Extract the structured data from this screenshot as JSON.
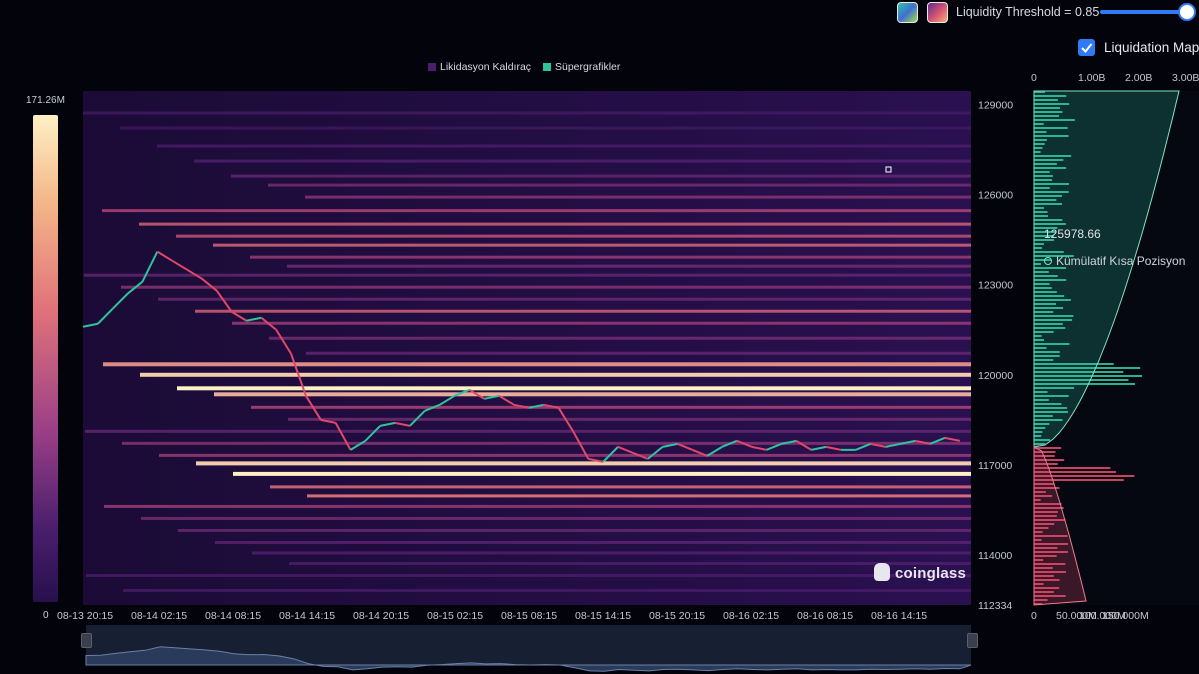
{
  "controls": {
    "threshold_label": "Liquidity Threshold = 0.85",
    "threshold_value": 0.85,
    "liquidation_map_label": "Liquidation Map",
    "liquidation_map_checked": true
  },
  "legend": [
    {
      "label": "Likidasyon Kaldıraç",
      "color": "#4a1e6d"
    },
    {
      "label": "Süpergrafikler",
      "color": "#2ec4a0"
    }
  ],
  "color_scale": {
    "max_label": "171.26M",
    "min_label": "0"
  },
  "tooltip": {
    "value": "125978.66",
    "series": "Kümülatif Kısa Pozisyon"
  },
  "watermark": "coinglass",
  "chart_data": {
    "type": "heatmap",
    "x_ticks": [
      "08-13 20:15",
      "08-14 02:15",
      "08-14 08:15",
      "08-14 14:15",
      "08-14 20:15",
      "08-15 02:15",
      "08-15 08:15",
      "08-15 14:15",
      "08-15 20:15",
      "08-16 02:15",
      "08-16 08:15",
      "08-16 14:15"
    ],
    "y_ticks": [
      129000,
      126000,
      123000,
      120000,
      117000,
      114000,
      112334
    ],
    "ylim": [
      112334,
      129450
    ],
    "price_series": {
      "name": "",
      "color_up": "#2ec4a0",
      "color_down": "#e0486a",
      "time_index": [
        0,
        4,
        8,
        12,
        16,
        20,
        24,
        28,
        32,
        36,
        40,
        44,
        48,
        52,
        56,
        60,
        64,
        68,
        72,
        76,
        80,
        84,
        88,
        92,
        96,
        100,
        104,
        108,
        112,
        116,
        120,
        124,
        128,
        132,
        136,
        140,
        144,
        148,
        152,
        156,
        160,
        164,
        168,
        172,
        176,
        180,
        184,
        188,
        192,
        196,
        200,
        204,
        208,
        212,
        216,
        220,
        224,
        228,
        232,
        236
      ],
      "values": [
        121600,
        121700,
        122200,
        122700,
        123100,
        124100,
        123800,
        123500,
        123200,
        122800,
        122100,
        121800,
        121900,
        121500,
        120700,
        119300,
        118500,
        118400,
        117500,
        117800,
        118300,
        118400,
        118300,
        118800,
        119000,
        119300,
        119500,
        119200,
        119300,
        119000,
        118900,
        119000,
        118900,
        118100,
        117200,
        117100,
        117600,
        117400,
        117200,
        117600,
        117700,
        117500,
        117300,
        117600,
        117800,
        117600,
        117500,
        117700,
        117800,
        117500,
        117600,
        117500,
        117500,
        117700,
        117600,
        117700,
        117800,
        117700,
        117900,
        117800
      ]
    },
    "liquidation_levels": [
      {
        "price": 128700,
        "intensity": 0.25
      },
      {
        "price": 128200,
        "intensity": 0.22
      },
      {
        "price": 127600,
        "intensity": 0.3
      },
      {
        "price": 127100,
        "intensity": 0.35
      },
      {
        "price": 126600,
        "intensity": 0.4
      },
      {
        "price": 126300,
        "intensity": 0.45
      },
      {
        "price": 125900,
        "intensity": 0.5
      },
      {
        "price": 125450,
        "intensity": 0.6
      },
      {
        "price": 125000,
        "intensity": 0.7
      },
      {
        "price": 124600,
        "intensity": 0.65
      },
      {
        "price": 124300,
        "intensity": 0.72
      },
      {
        "price": 123900,
        "intensity": 0.55
      },
      {
        "price": 123600,
        "intensity": 0.45
      },
      {
        "price": 123300,
        "intensity": 0.4
      },
      {
        "price": 122900,
        "intensity": 0.5
      },
      {
        "price": 122500,
        "intensity": 0.42
      },
      {
        "price": 122100,
        "intensity": 0.7
      },
      {
        "price": 121700,
        "intensity": 0.55
      },
      {
        "price": 121200,
        "intensity": 0.45
      },
      {
        "price": 120700,
        "intensity": 0.4
      },
      {
        "price": 120350,
        "intensity": 0.85
      },
      {
        "price": 120000,
        "intensity": 0.95
      },
      {
        "price": 119550,
        "intensity": 1.0
      },
      {
        "price": 119350,
        "intensity": 0.9
      },
      {
        "price": 118900,
        "intensity": 0.6
      },
      {
        "price": 118500,
        "intensity": 0.45
      },
      {
        "price": 118100,
        "intensity": 0.4
      },
      {
        "price": 117700,
        "intensity": 0.5
      },
      {
        "price": 117300,
        "intensity": 0.55
      },
      {
        "price": 117050,
        "intensity": 0.95
      },
      {
        "price": 116700,
        "intensity": 1.0
      },
      {
        "price": 116250,
        "intensity": 0.75
      },
      {
        "price": 115950,
        "intensity": 0.8
      },
      {
        "price": 115600,
        "intensity": 0.55
      },
      {
        "price": 115200,
        "intensity": 0.45
      },
      {
        "price": 114800,
        "intensity": 0.42
      },
      {
        "price": 114400,
        "intensity": 0.38
      },
      {
        "price": 114050,
        "intensity": 0.35
      },
      {
        "price": 113700,
        "intensity": 0.33
      },
      {
        "price": 113300,
        "intensity": 0.3
      },
      {
        "price": 112800,
        "intensity": 0.28
      }
    ],
    "side_panel": {
      "top_axis_ticks": [
        "0",
        "1.00B",
        "2.00B",
        "3.00B"
      ],
      "bottom_axis_ticks": [
        "0",
        "50.000M",
        "100.000M",
        "150.000M"
      ],
      "series": [
        {
          "name": "Kümülatif Kısa Pozisyon",
          "color": "#2ec4a0"
        },
        {
          "name": "",
          "color": "#e0486a"
        }
      ]
    }
  }
}
